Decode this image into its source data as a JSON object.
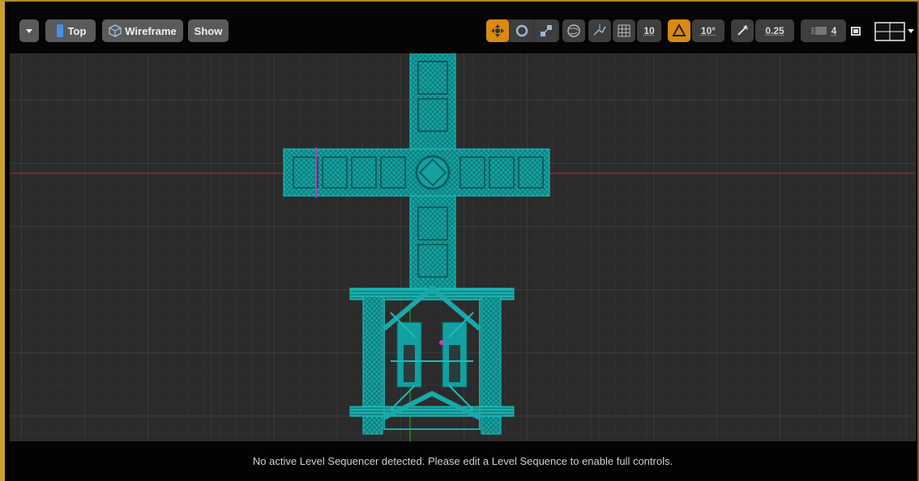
{
  "toolbar": {
    "options_menu_icon": "chevron-down-icon",
    "view_label": "Top",
    "view_mode_label": "Wireframe",
    "show_label": "Show",
    "grid_snap_value": "10",
    "rotation_snap_value": "10°",
    "scale_snap_value": "0.25",
    "camera_speed_value": "4",
    "icons": [
      "translate-icon",
      "rotate-icon",
      "scale-icon",
      "world-local-icon",
      "surface-snap-icon",
      "grid-icon",
      "angle-snap-icon",
      "scale-snap-icon",
      "camera-speed-icon",
      "maximize-icon",
      "layout-icon"
    ]
  },
  "colors": {
    "mesh": "#1aa0a0",
    "grid": "#3c3c3c",
    "x_axis": "#b02020",
    "y_axis": "#20a020",
    "accent": "#d98a10",
    "border": "#c8a030"
  },
  "status_bar": {
    "message": "No active Level Sequencer detected. Please edit a Level Sequence to enable full controls."
  }
}
